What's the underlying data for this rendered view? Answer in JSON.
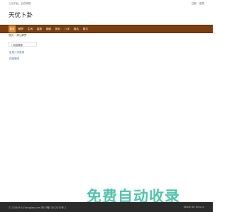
{
  "topbar": {
    "slogan": "三元平台，云在网络",
    "links": [
      "注册",
      "登录"
    ]
  },
  "site": {
    "logo_text": "天优卜卦"
  },
  "nav": {
    "items": [
      "首页",
      "解梦",
      "生肖",
      "星座",
      "姻缘",
      "配对",
      "八字",
      "取名",
      "数字"
    ],
    "active_index": 0
  },
  "breadcrumb": {
    "home": "首页",
    "separator": "›",
    "current": "周公解梦"
  },
  "panel": {
    "title": "精品推荐",
    "icon": "star-icon"
  },
  "links": [
    "生肖八字查询",
    "在线测试"
  ],
  "footer": {
    "left": "© 2016 什么Zhangjiao.com 鲁ICP备13012070号-1",
    "right": "design by tucu.cn"
  },
  "watermark": {
    "text": "免费自动收录"
  },
  "colors": {
    "nav_bg": "#7b3f10",
    "nav_active": "#d58a2b",
    "watermark": "#49c1a6",
    "link": "#2b59c3"
  }
}
